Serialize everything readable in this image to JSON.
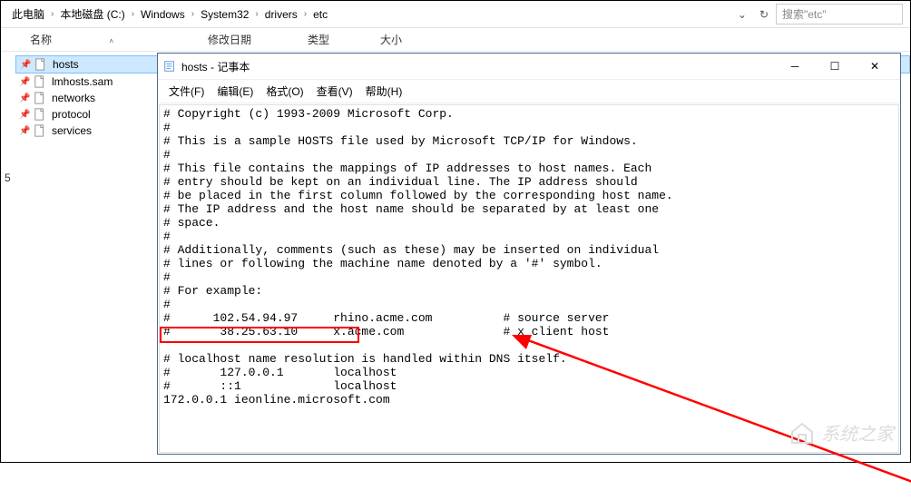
{
  "breadcrumb": {
    "items": [
      "此电脑",
      "本地磁盘 (C:)",
      "Windows",
      "System32",
      "drivers",
      "etc"
    ]
  },
  "search": {
    "placeholder": "搜索\"etc\""
  },
  "columns": {
    "name": "名称",
    "date": "修改日期",
    "type": "类型",
    "size": "大小"
  },
  "files": {
    "items": [
      {
        "name": "hosts",
        "selected": true
      },
      {
        "name": "lmhosts.sam",
        "selected": false
      },
      {
        "name": "networks",
        "selected": false
      },
      {
        "name": "protocol",
        "selected": false
      },
      {
        "name": "services",
        "selected": false
      }
    ]
  },
  "row_count": "5",
  "notepad": {
    "title": "hosts - 记事本",
    "menu": {
      "file": "文件(F)",
      "edit": "编辑(E)",
      "format": "格式(O)",
      "view": "查看(V)",
      "help": "帮助(H)"
    },
    "content": "# Copyright (c) 1993-2009 Microsoft Corp.\n#\n# This is a sample HOSTS file used by Microsoft TCP/IP for Windows.\n#\n# This file contains the mappings of IP addresses to host names. Each\n# entry should be kept on an individual line. The IP address should\n# be placed in the first column followed by the corresponding host name.\n# The IP address and the host name should be separated by at least one\n# space.\n#\n# Additionally, comments (such as these) may be inserted on individual\n# lines or following the machine name denoted by a '#' symbol.\n#\n# For example:\n#\n#      102.54.94.97     rhino.acme.com          # source server\n#       38.25.63.10     x.acme.com              # x client host\n\n# localhost name resolution is handled within DNS itself.\n#       127.0.0.1       localhost\n#       ::1             localhost\n172.0.0.1 ieonline.microsoft.com"
  },
  "watermark": "系统之家"
}
